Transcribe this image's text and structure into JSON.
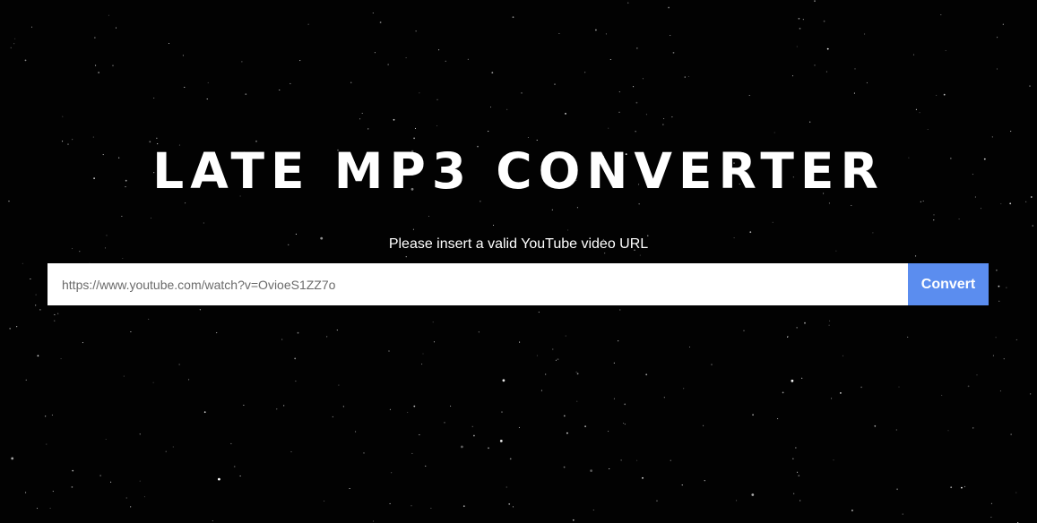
{
  "app": {
    "title": "LATE MP3 CONVERTER"
  },
  "form": {
    "instruction": "Please insert a valid YouTube video URL",
    "url_value": "https://www.youtube.com/watch?v=OvioeS1ZZ7o",
    "convert_label": "Convert"
  },
  "colors": {
    "background": "#020202",
    "text": "#ffffff",
    "button": "#5b8def",
    "input_text": "#6b6b6b"
  }
}
